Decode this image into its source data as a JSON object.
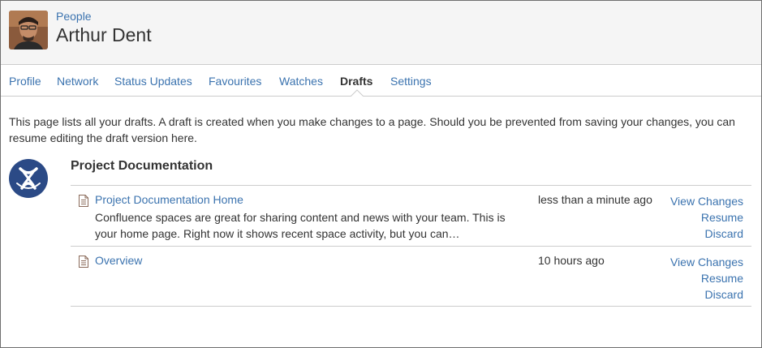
{
  "header": {
    "breadcrumb": "People",
    "title": "Arthur Dent"
  },
  "tabs": [
    {
      "label": "Profile",
      "active": false
    },
    {
      "label": "Network",
      "active": false
    },
    {
      "label": "Status Updates",
      "active": false
    },
    {
      "label": "Favourites",
      "active": false
    },
    {
      "label": "Watches",
      "active": false
    },
    {
      "label": "Drafts",
      "active": true
    },
    {
      "label": "Settings",
      "active": false
    }
  ],
  "intro": "This page lists all your drafts. A draft is created when you make changes to a page. Should you be prevented from saving your changes, you can resume editing the draft version here.",
  "space": {
    "title": "Project Documentation",
    "logo_icon": "confluence-space-icon"
  },
  "drafts": [
    {
      "title": "Project Documentation Home",
      "excerpt": "Confluence spaces are great for sharing content and news with your team. This is your home page. Right now it shows recent space activity, but you can…",
      "time": "less than a minute ago",
      "actions": {
        "view": "View Changes",
        "resume": "Resume",
        "discard": "Discard"
      }
    },
    {
      "title": "Overview",
      "excerpt": "",
      "time": "10 hours ago",
      "actions": {
        "view": "View Changes",
        "resume": "Resume",
        "discard": "Discard"
      }
    }
  ],
  "colors": {
    "link": "#3b73af",
    "text": "#333333",
    "header_bg": "#f5f5f5",
    "border": "#cccccc",
    "space_logo": "#2b4a86"
  }
}
